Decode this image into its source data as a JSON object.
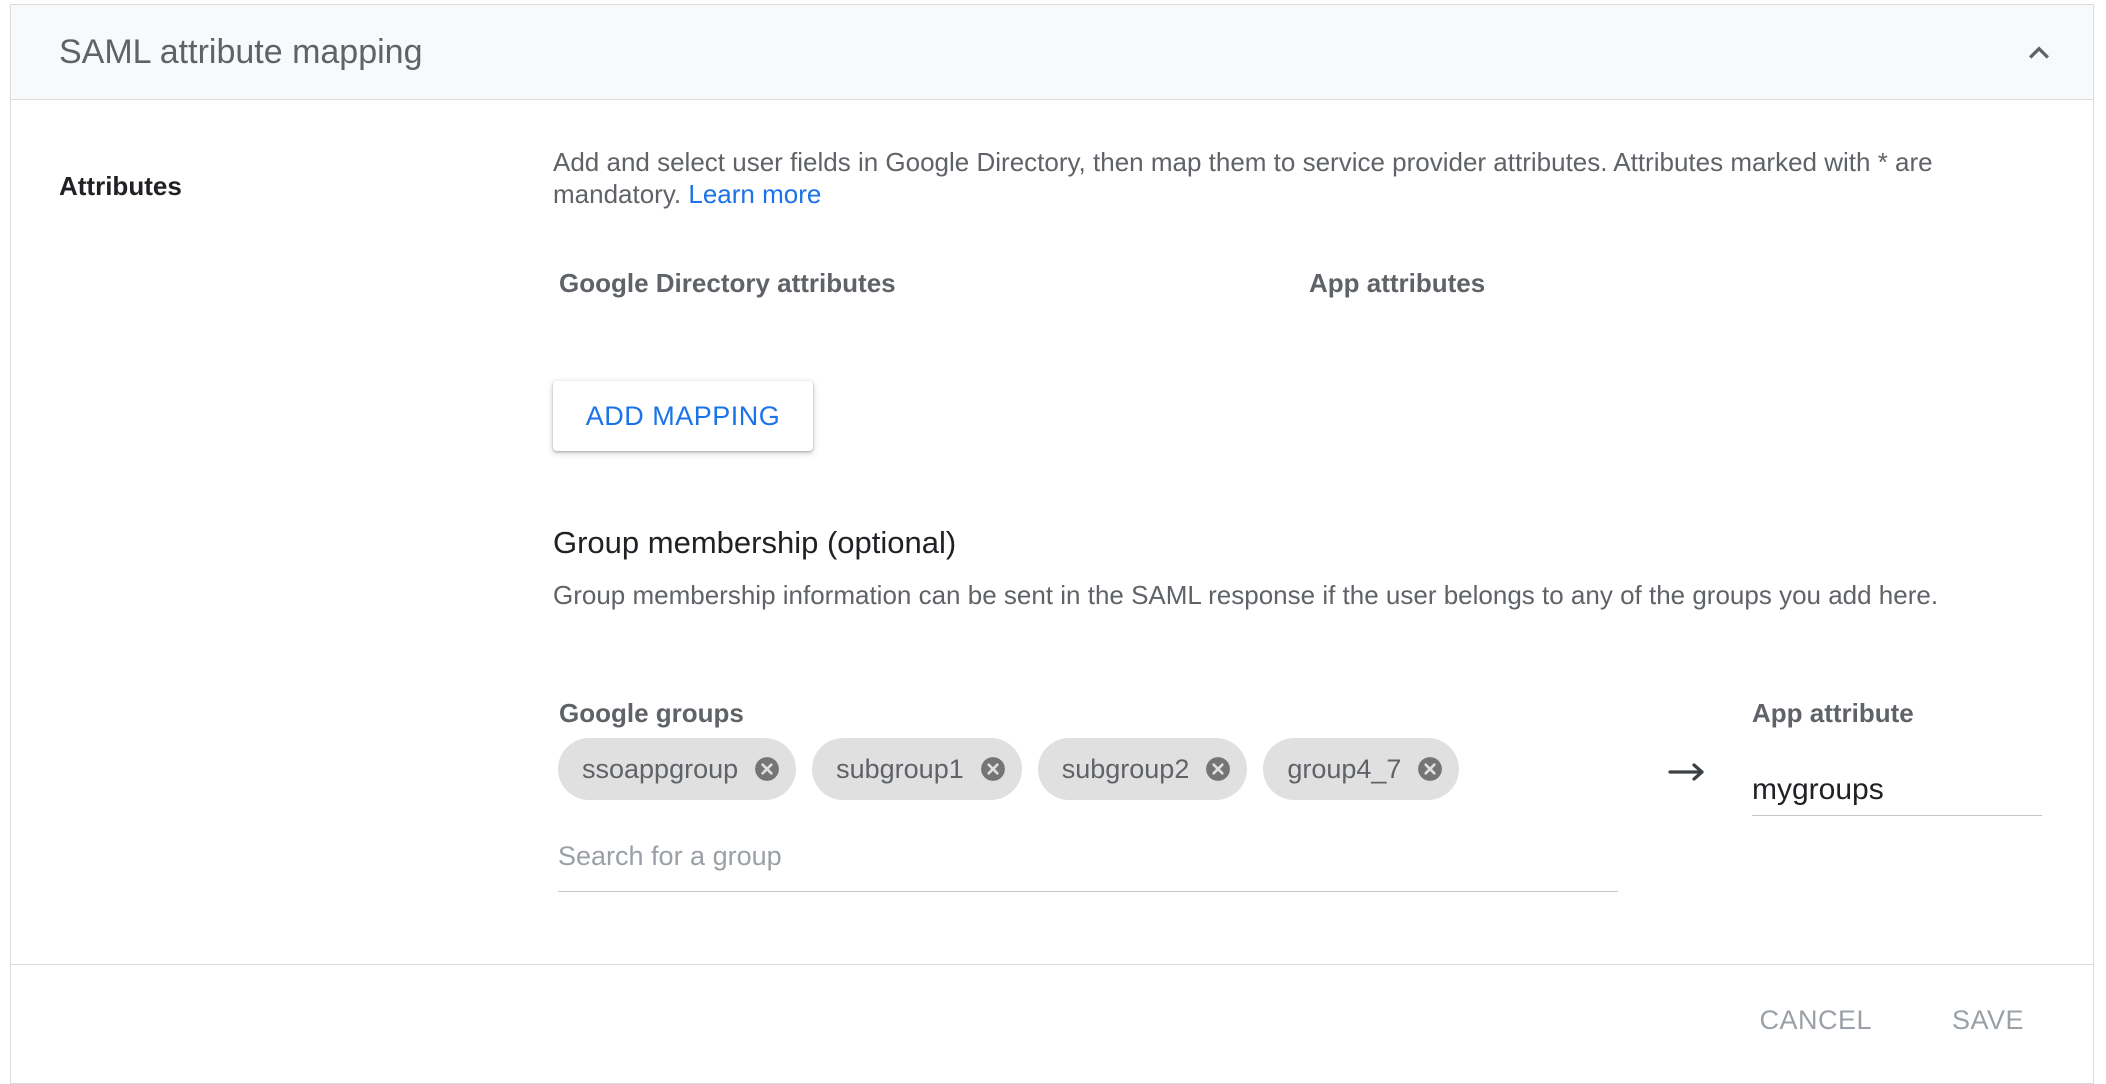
{
  "card": {
    "title": "SAML attribute mapping"
  },
  "attributes": {
    "label": "Attributes",
    "description": "Add and select user fields in Google Directory, then map them to service provider attributes. Attributes marked with * are mandatory.",
    "learn_more": "Learn more",
    "col_directory": "Google Directory attributes",
    "col_app": "App attributes",
    "add_mapping": "ADD MAPPING"
  },
  "groups": {
    "title": "Group membership (optional)",
    "description": "Group membership information can be sent in the SAML response if the user belongs to any of the groups you add here.",
    "col_groups": "Google groups",
    "col_app_attr": "App attribute",
    "chips": [
      "ssoappgroup",
      "subgroup1",
      "subgroup2",
      "group4_7"
    ],
    "search_placeholder": "Search for a group",
    "search_value": "",
    "app_attribute_value": "mygroups"
  },
  "footer": {
    "cancel": "CANCEL",
    "save": "SAVE"
  },
  "icons": {
    "collapse": "chevron-up-icon",
    "chip_remove": "cancel-circle-icon",
    "arrow": "arrow-right-icon"
  },
  "colors": {
    "link": "#1a73e8",
    "header_bg": "#f8f9fa",
    "chip_bg": "#e0e0e0",
    "disabled_text": "#9aa0a6"
  }
}
